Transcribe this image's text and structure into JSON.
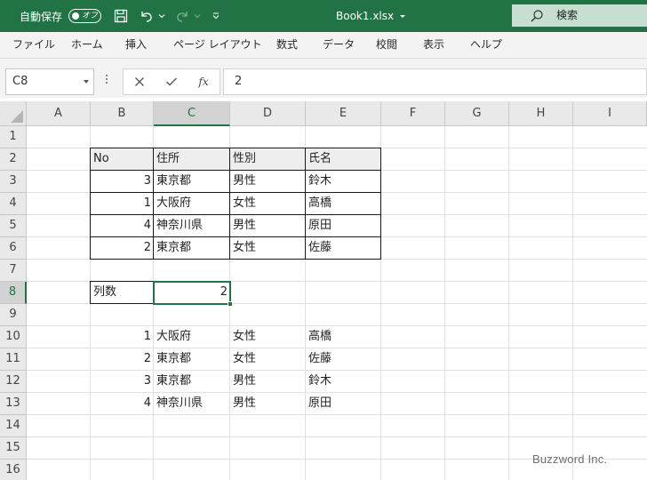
{
  "titlebar": {
    "autosave_label": "自動保存",
    "autosave_state": "オフ",
    "title": "Book1.xlsx",
    "search_label": "検索"
  },
  "ribbon": {
    "tabs": [
      "ファイル",
      "ホーム",
      "挿入",
      "ページ レイアウト",
      "数式",
      "データ",
      "校閲",
      "表示",
      "ヘルプ"
    ]
  },
  "formula_bar": {
    "name_box": "C8",
    "formula": "2",
    "fx_label": "fx"
  },
  "grid": {
    "columns": [
      "A",
      "B",
      "C",
      "D",
      "E",
      "F",
      "G",
      "H",
      "I"
    ],
    "rows": [
      "1",
      "2",
      "3",
      "4",
      "5",
      "6",
      "7",
      "8",
      "9",
      "10",
      "11",
      "12",
      "13",
      "14",
      "15",
      "16"
    ],
    "selected_column": "C",
    "selected_row": "8",
    "table1": {
      "headers": [
        "No",
        "住所",
        "性別",
        "氏名"
      ],
      "rows": [
        [
          "3",
          "東京都",
          "男性",
          "鈴木"
        ],
        [
          "1",
          "大阪府",
          "女性",
          "高橋"
        ],
        [
          "4",
          "神奈川県",
          "男性",
          "原田"
        ],
        [
          "2",
          "東京都",
          "女性",
          "佐藤"
        ]
      ]
    },
    "param": {
      "label": "列数",
      "value": "2"
    },
    "result": {
      "rows": [
        [
          "1",
          "大阪府",
          "女性",
          "高橋"
        ],
        [
          "2",
          "東京都",
          "女性",
          "佐藤"
        ],
        [
          "3",
          "東京都",
          "男性",
          "鈴木"
        ],
        [
          "4",
          "神奈川県",
          "男性",
          "原田"
        ]
      ]
    }
  },
  "watermark": "Buzzword Inc.",
  "colors": {
    "excel_green": "#217346",
    "header_fill": "#eeeeee"
  }
}
